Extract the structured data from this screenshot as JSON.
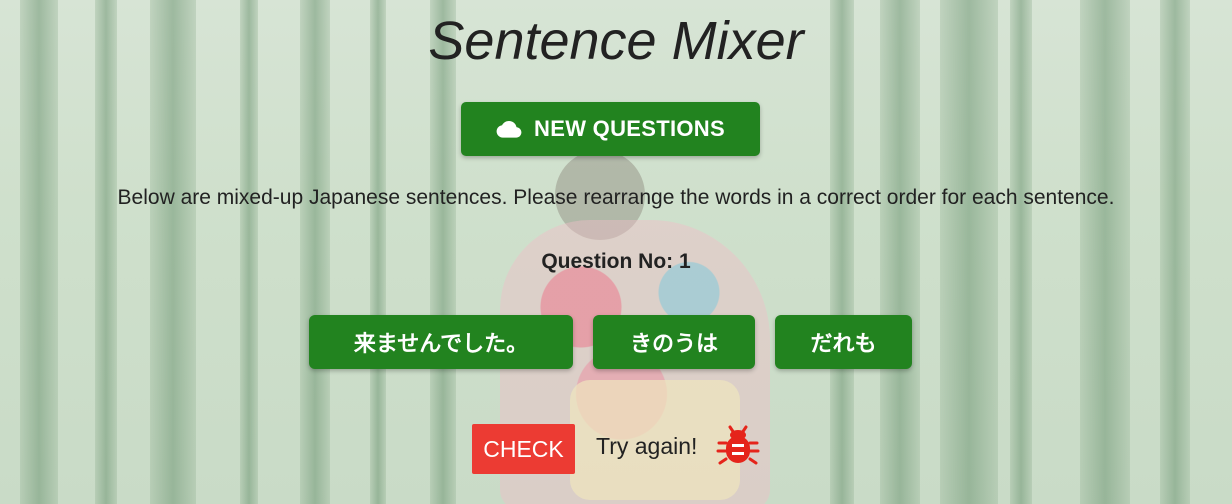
{
  "app": {
    "title": "Sentence Mixer",
    "new_questions_label": "NEW QUESTIONS",
    "new_questions_icon": "cloud-icon",
    "instructions": "Below are mixed-up Japanese sentences. Please rearrange the words in a correct order for each sentence.",
    "question_label": "Question No: 1"
  },
  "words": [
    "来ませんでした。",
    "きのうは",
    "だれも"
  ],
  "check": {
    "label": "CHECK",
    "result_text": "Try again!",
    "result_icon": "bug-icon"
  },
  "colors": {
    "primary_green": "#22831f",
    "check_red": "#ec3b33",
    "bug_red": "#e5241b"
  }
}
